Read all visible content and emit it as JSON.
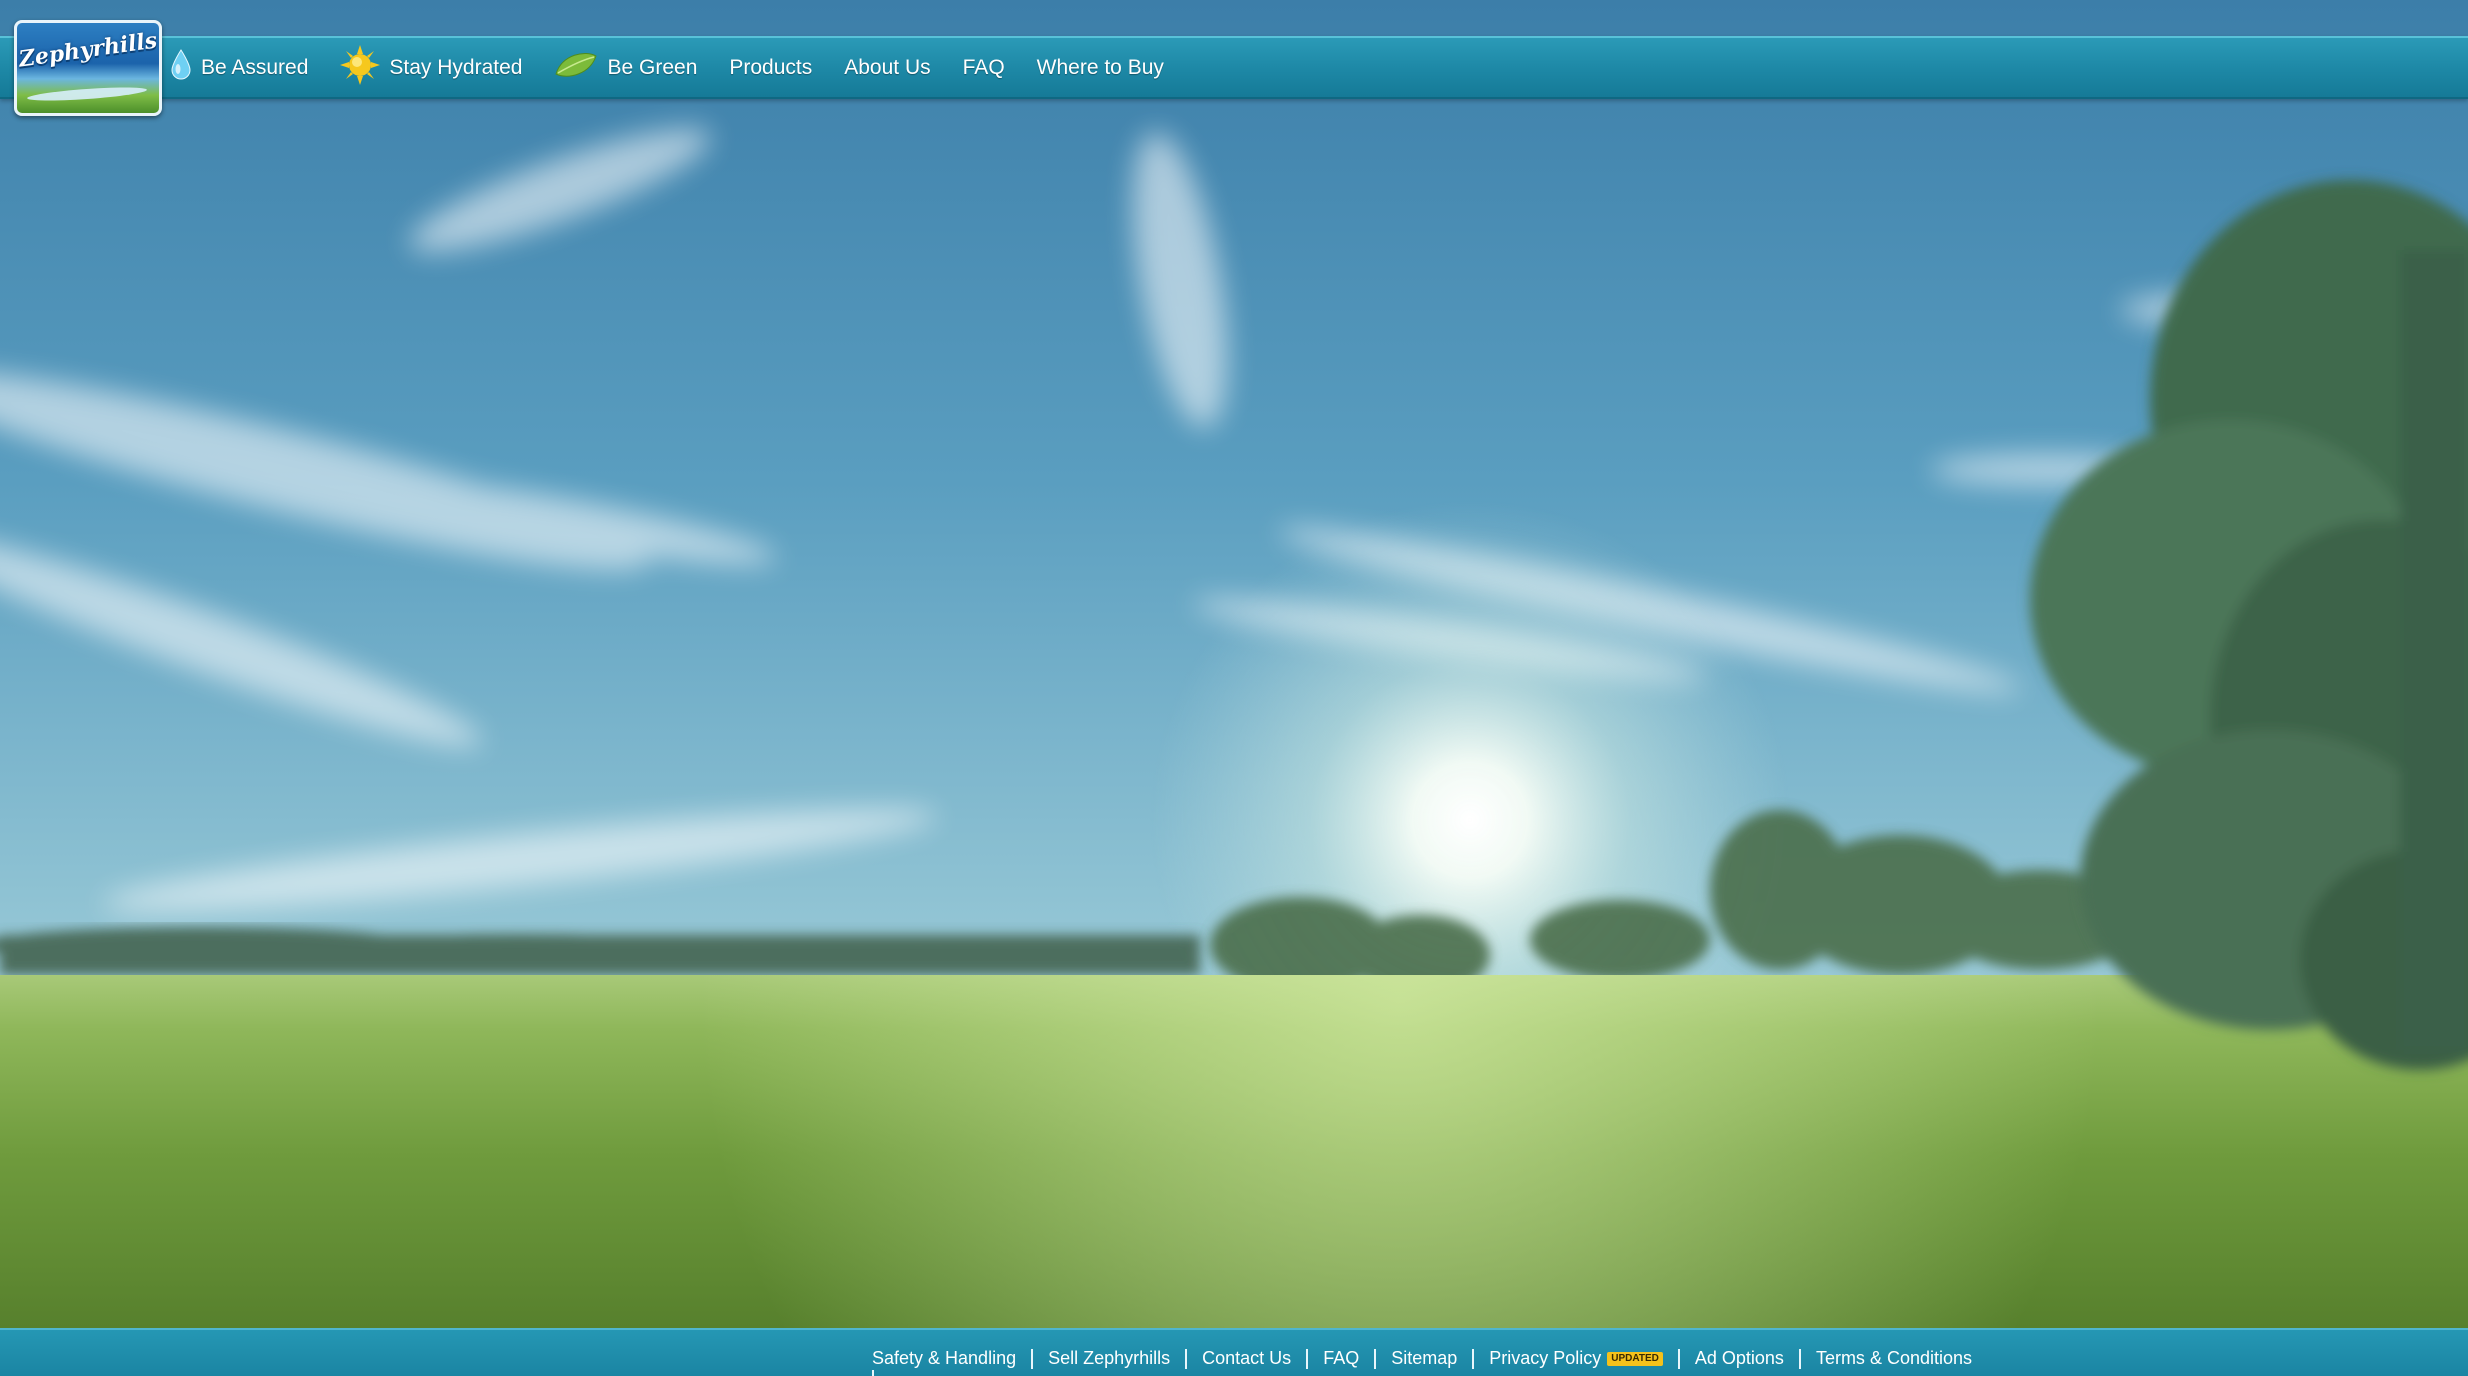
{
  "brand": {
    "logo_text": "Zephyrhills"
  },
  "nav": {
    "items": [
      {
        "label": "Be Assured",
        "icon": "water-drop-icon"
      },
      {
        "label": "Stay Hydrated",
        "icon": "sun-icon"
      },
      {
        "label": "Be Green",
        "icon": "leaf-icon"
      },
      {
        "label": "Products"
      },
      {
        "label": "About Us"
      },
      {
        "label": "FAQ"
      },
      {
        "label": "Where to Buy"
      }
    ]
  },
  "footer": {
    "links": [
      {
        "label": "Safety & Handling"
      },
      {
        "label": "Sell Zephyrhills"
      },
      {
        "label": "Contact Us"
      },
      {
        "label": "FAQ"
      },
      {
        "label": "Sitemap"
      },
      {
        "label": "Privacy Policy",
        "badge": "UPDATED"
      },
      {
        "label": "Ad Options"
      },
      {
        "label": "Terms & Conditions"
      }
    ]
  },
  "colors": {
    "bar": "#1e89a7",
    "sky_top": "#3b7fae",
    "sky_horizon": "#d6ecef",
    "grass": "#6e9a3a",
    "badge": "#f5c21b"
  }
}
